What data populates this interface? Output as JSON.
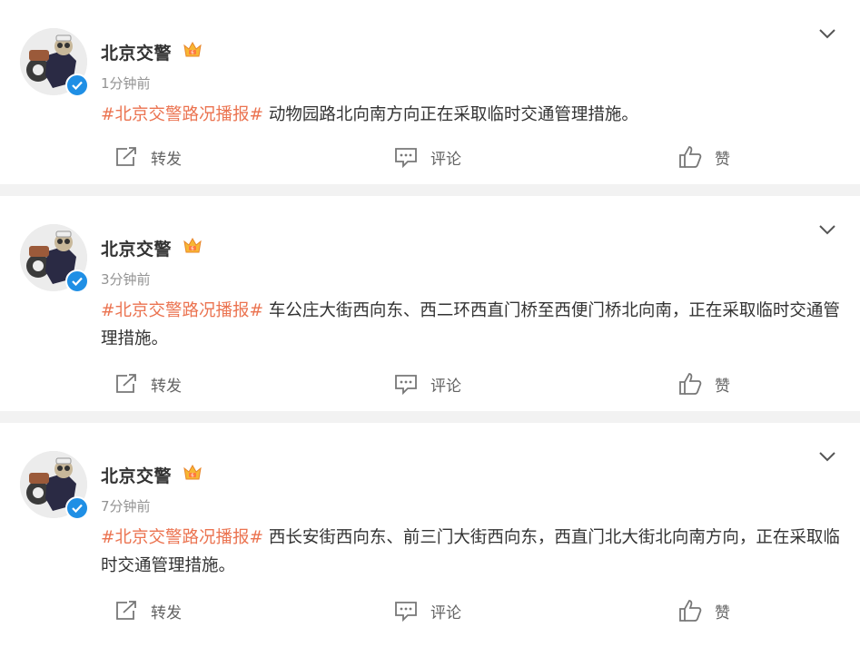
{
  "posts": [
    {
      "author": "北京交警",
      "time": "1分钟前",
      "hashtag": "#北京交警路况播报#",
      "text": " 动物园路北向南方向正在采取临时交通管理措施。",
      "repost_label": "转发",
      "comment_label": "评论",
      "like_label": "赞"
    },
    {
      "author": "北京交警",
      "time": "3分钟前",
      "hashtag": "#北京交警路况播报#",
      "text": " 车公庄大街西向东、西二环西直门桥至西便门桥北向南，正在采取临时交通管理措施。",
      "repost_label": "转发",
      "comment_label": "评论",
      "like_label": "赞"
    },
    {
      "author": "北京交警",
      "time": "7分钟前",
      "hashtag": "#北京交警路况播报#",
      "text": " 西长安街西向东、前三门大街西向东，西直门北大街北向南方向，正在采取临时交通管理措施。",
      "repost_label": "转发",
      "comment_label": "评论",
      "like_label": "赞"
    }
  ],
  "colors": {
    "hashtag": "#eb7350",
    "verified_badge": "#1f8fe5",
    "separator": "#f2f2f2",
    "time_text": "#939393"
  },
  "icons": {
    "verified": "verified-check-icon",
    "vip": "crown-badge-icon",
    "menu": "chevron-down-icon",
    "repost": "share-arrow-icon",
    "comment": "speech-bubble-icon",
    "like": "thumbs-up-icon"
  }
}
